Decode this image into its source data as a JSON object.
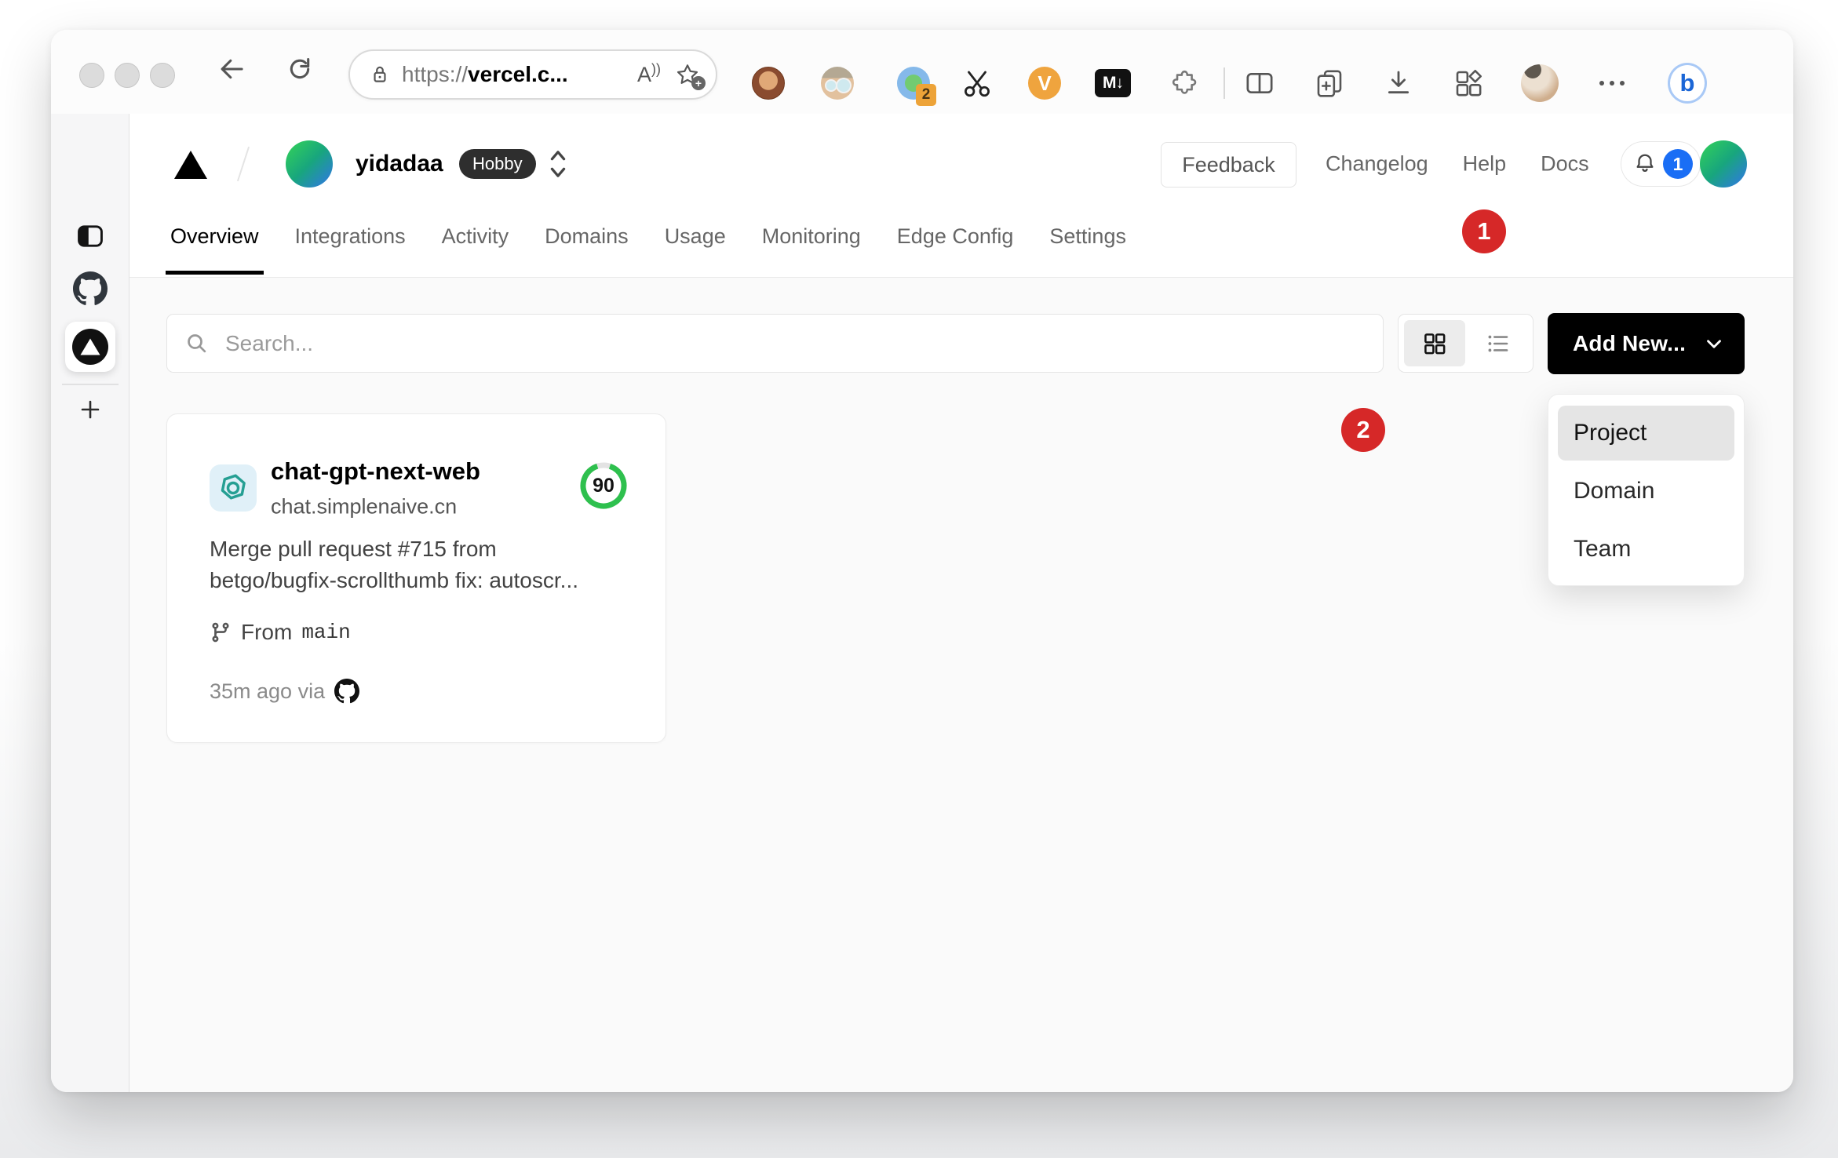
{
  "browser": {
    "address": {
      "prefix": "https://",
      "domain": "vercel.c..."
    },
    "read_aloud_label": "A",
    "extensions": {
      "notification_badge": "2",
      "vimium_label": "V",
      "markdown_label": "M↓"
    },
    "bing_label": "b"
  },
  "vercel": {
    "header": {
      "team_name": "yidadaa",
      "plan_badge": "Hobby",
      "feedback_label": "Feedback",
      "nav_links": [
        {
          "label": "Changelog"
        },
        {
          "label": "Help"
        },
        {
          "label": "Docs"
        }
      ],
      "notification_count": "1"
    },
    "tabs": [
      {
        "label": "Overview",
        "active": true
      },
      {
        "label": "Integrations"
      },
      {
        "label": "Activity"
      },
      {
        "label": "Domains"
      },
      {
        "label": "Usage"
      },
      {
        "label": "Monitoring"
      },
      {
        "label": "Edge Config"
      },
      {
        "label": "Settings"
      }
    ],
    "controls": {
      "search_placeholder": "Search...",
      "add_new_label": "Add New..."
    },
    "add_new_menu": {
      "items": [
        {
          "label": "Project",
          "highlighted": true
        },
        {
          "label": "Domain"
        },
        {
          "label": "Team"
        }
      ]
    },
    "project_card": {
      "name": "chat-gpt-next-web",
      "domain": "chat.simplenaive.cn",
      "score": "90",
      "commit_line1": "Merge pull request #715 from",
      "commit_line2": "betgo/bugfix-scrollthumb fix: autoscr...",
      "branch_label": "From",
      "branch_name": "main",
      "time_label": "35m ago via"
    }
  },
  "annotations": {
    "step_1": "1",
    "step_2": "2",
    "arrow_color": "#d62828",
    "score_green": "#2ec04e",
    "badge_blue": "#1a6ef5"
  }
}
